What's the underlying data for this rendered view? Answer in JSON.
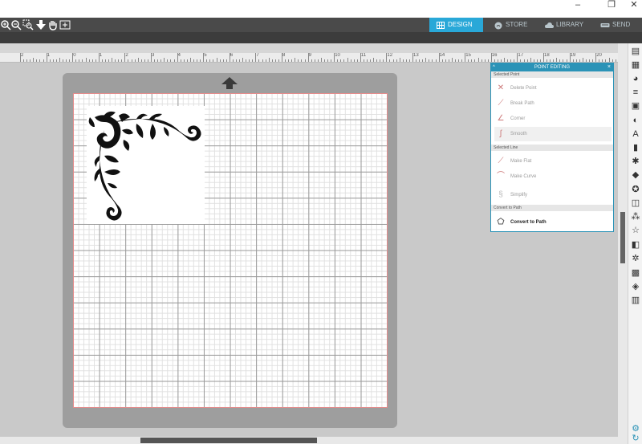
{
  "window": {
    "minimize": "–",
    "restore": "❐",
    "close": "✕"
  },
  "toolbar_icons": [
    "zoom-in-icon",
    "zoom-out-icon",
    "zoom-selection-icon",
    "move-down-icon",
    "pan-hand-icon",
    "fit-to-page-icon"
  ],
  "nav": {
    "tabs": [
      {
        "label": "DESIGN",
        "active": true
      },
      {
        "label": "STORE",
        "active": false
      },
      {
        "label": "LIBRARY",
        "active": false
      },
      {
        "label": "SEND",
        "active": false
      }
    ]
  },
  "ruler": {
    "labels": [
      "2",
      "1",
      "0",
      "1",
      "2",
      "3",
      "4",
      "5",
      "6",
      "7",
      "8",
      "9",
      "10",
      "11",
      "12",
      "13",
      "14",
      "15",
      "16",
      "17",
      "18",
      "19",
      "20"
    ]
  },
  "panel": {
    "title": "POINT EDITING",
    "collapse": "^",
    "close": "×",
    "sections": {
      "selected_point": "Selected Point",
      "selected_line": "Selected Line",
      "convert": "Convert to Path"
    },
    "point_items": [
      "Delete Point",
      "Break Path",
      "Corner",
      "Smooth"
    ],
    "line_items": [
      "Make Flat",
      "Make Curve",
      "Simplify"
    ],
    "convert_item": "Convert to Path"
  },
  "colors": {
    "accent": "#29a8d8",
    "panel_accent": "#2b93b7",
    "mat": "#9e9e9e",
    "grid_border": "#e58c8c"
  }
}
